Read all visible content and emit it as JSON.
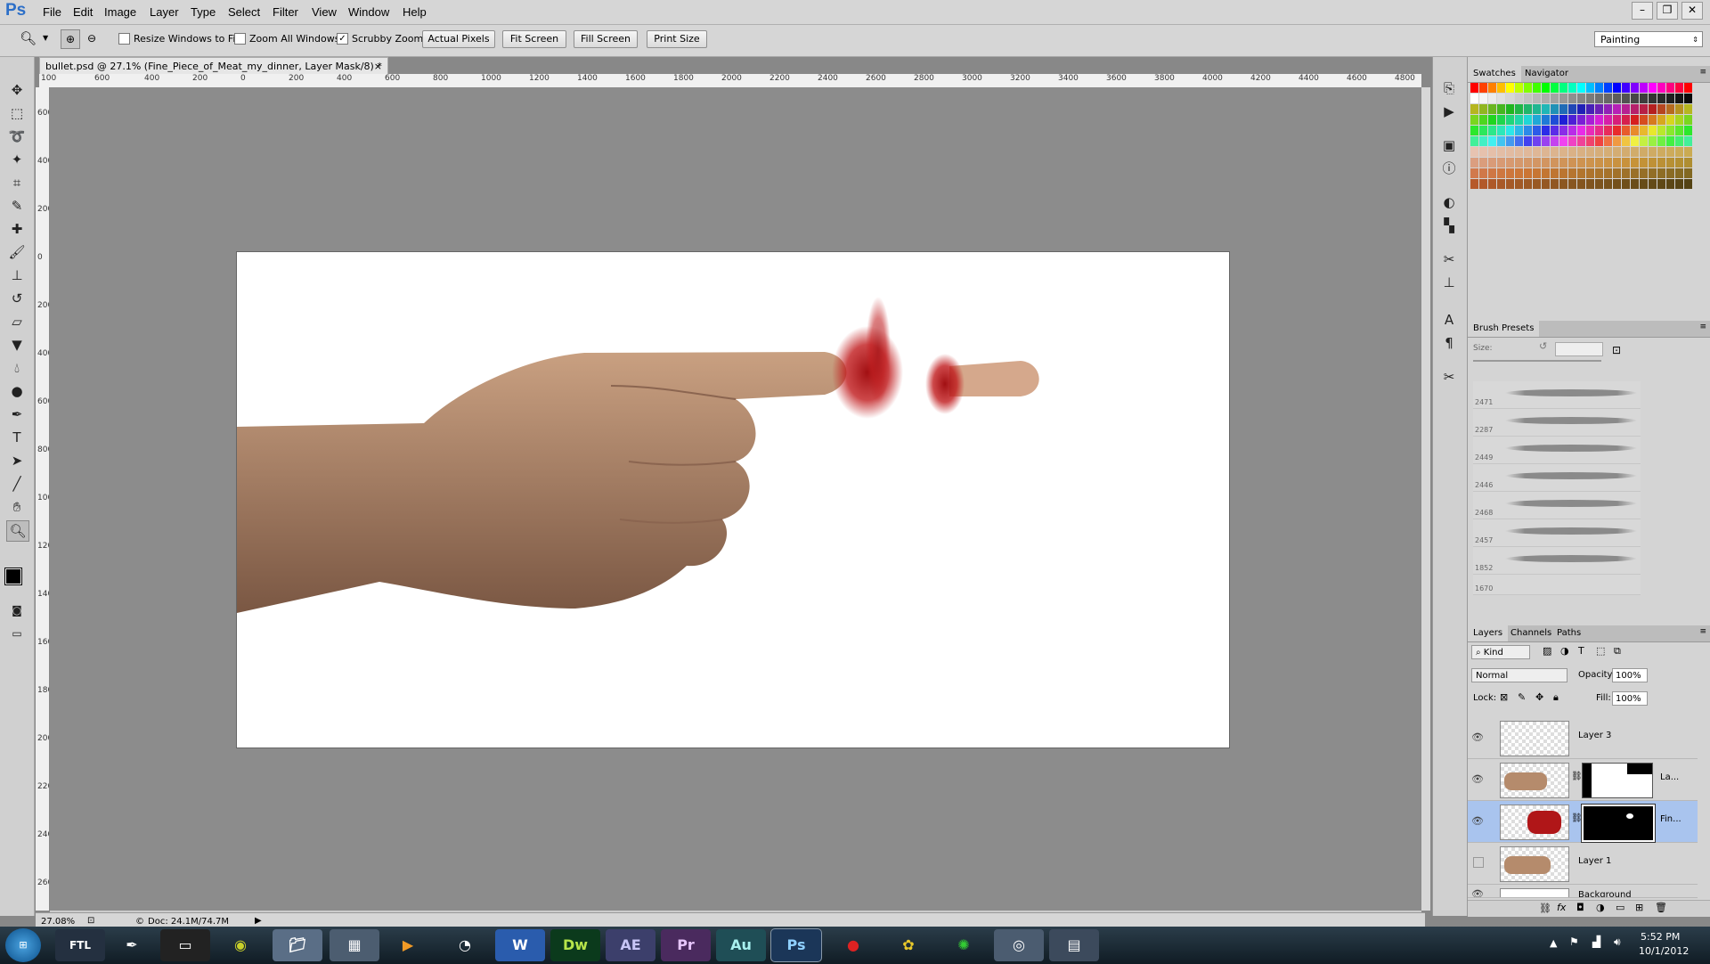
{
  "app": {
    "logo": "Ps"
  },
  "menu": [
    "File",
    "Edit",
    "Image",
    "Layer",
    "Type",
    "Select",
    "Filter",
    "View",
    "Window",
    "Help"
  ],
  "window_controls": [
    "–",
    "❐",
    "✕"
  ],
  "options": {
    "resize_windows": "Resize Windows to Fit",
    "zoom_all": "Zoom All Windows",
    "scrubby_zoom": "Scrubby Zoom",
    "actual_pixels": "Actual Pixels",
    "fit_screen": "Fit Screen",
    "fill_screen": "Fill Screen",
    "print_size": "Print Size",
    "workspace": "Painting"
  },
  "document": {
    "tab_title": "bullet.psd @ 27.1% (Fine_Piece_of_Meat_my_dinner, Layer Mask/8) *",
    "zoom": "27.08%",
    "doc_size": "Doc: 24.1M/74.7M"
  },
  "ruler_h": [
    "100",
    "600",
    "400",
    "200",
    "0",
    "200",
    "400",
    "600",
    "800",
    "1000",
    "1200",
    "1400",
    "1600",
    "1800",
    "2000",
    "2200",
    "2400",
    "2600",
    "2800",
    "3000",
    "3200",
    "3400",
    "3600",
    "3800",
    "4000",
    "4200",
    "4400",
    "4600",
    "4800"
  ],
  "ruler_v": [
    "600",
    "400",
    "200",
    "0",
    "200",
    "400",
    "600",
    "800",
    "1000",
    "1200",
    "1400",
    "1600",
    "1800",
    "2000",
    "2200",
    "2400",
    "2600"
  ],
  "panels": {
    "swatches_tab": "Swatches",
    "navigator_tab": "Navigator",
    "brush_presets_tab": "Brush Presets",
    "size_label": "Size:",
    "brush_sizes": [
      "2471",
      "2287",
      "2449",
      "2446",
      "2468",
      "2457",
      "1852",
      "1670"
    ],
    "layers_tab": "Layers",
    "channels_tab": "Channels",
    "paths_tab": "Paths",
    "kind": "Kind",
    "blend_mode": "Normal",
    "opacity_label": "Opacity:",
    "opacity": "100%",
    "lock_label": "Lock:",
    "fill_label": "Fill:",
    "fill": "100%"
  },
  "layers": [
    {
      "name": "Layer 3"
    },
    {
      "name": "La..."
    },
    {
      "name": "Fin..."
    },
    {
      "name": "Layer 1"
    },
    {
      "name": "Background"
    }
  ],
  "taskbar": {
    "apps": [
      "FTL",
      "Dw",
      "AE",
      "Pr",
      "Au",
      "Ps"
    ],
    "time": "5:52 PM",
    "date": "10/1/2012"
  },
  "colors": {
    "accent": "#2c6fc8",
    "selected_layer": "#a9c4ee",
    "foreground": "#000000",
    "background": "#ffffff"
  }
}
